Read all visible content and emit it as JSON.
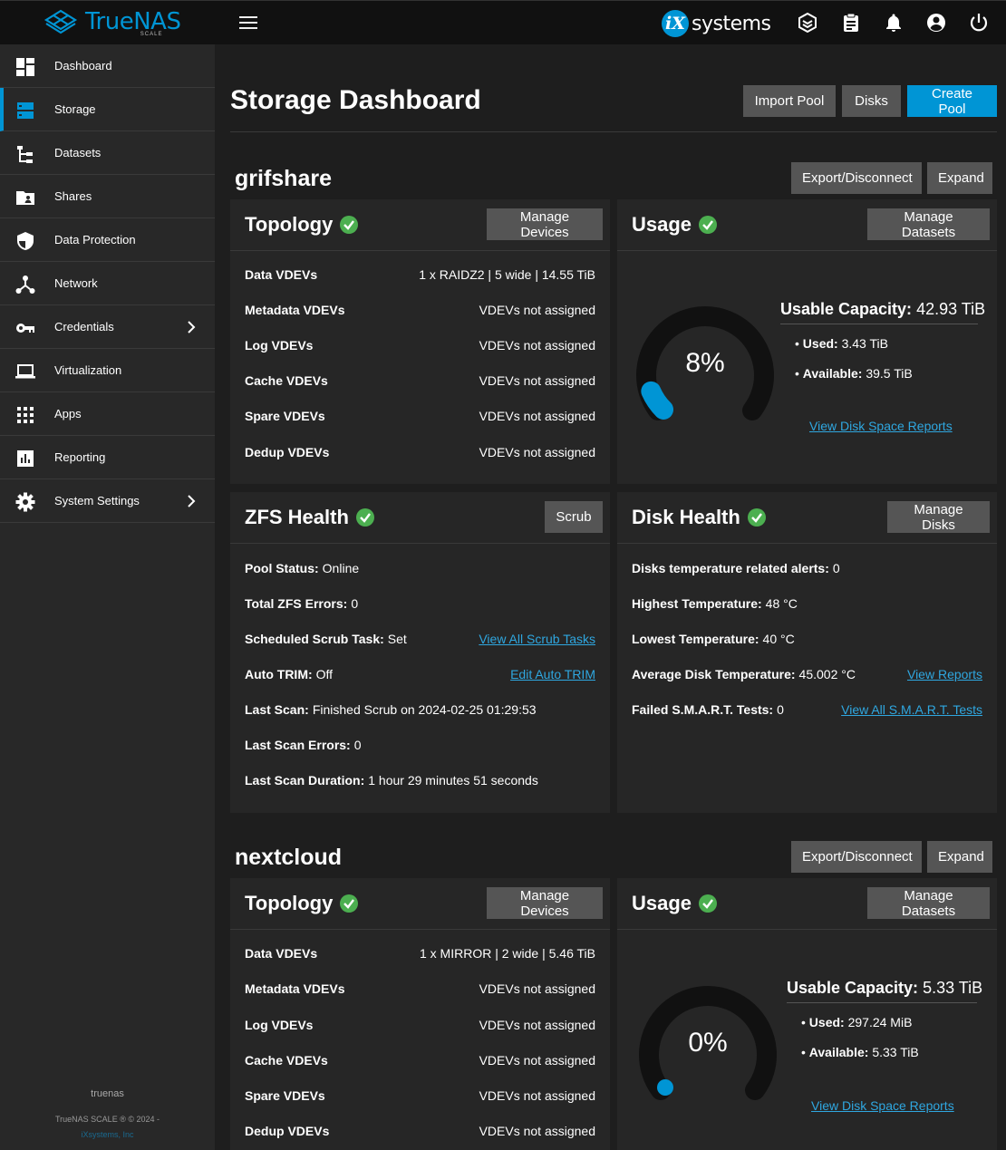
{
  "brand": {
    "name": "TrueNAS",
    "edition": "SCALE"
  },
  "vendor": {
    "mark": "iX",
    "name": "systems"
  },
  "sidebar": {
    "items": [
      {
        "label": "Dashboard"
      },
      {
        "label": "Storage"
      },
      {
        "label": "Datasets"
      },
      {
        "label": "Shares"
      },
      {
        "label": "Data Protection"
      },
      {
        "label": "Network"
      },
      {
        "label": "Credentials"
      },
      {
        "label": "Virtualization"
      },
      {
        "label": "Apps"
      },
      {
        "label": "Reporting"
      },
      {
        "label": "System Settings"
      }
    ],
    "hostname": "truenas",
    "copyright": "TrueNAS SCALE ® © 2024 -",
    "company": "iXsystems, Inc"
  },
  "header": {
    "title": "Storage Dashboard",
    "import_label": "Import Pool",
    "disks_label": "Disks",
    "create_label": "Create Pool"
  },
  "pools": [
    {
      "name": "grifshare",
      "export_label": "Export/Disconnect",
      "expand_label": "Expand",
      "topology": {
        "title": "Topology",
        "button": "Manage Devices",
        "rows": [
          {
            "k": "Data VDEVs",
            "v": "1 x RAIDZ2 | 5 wide | 14.55 TiB"
          },
          {
            "k": "Metadata VDEVs",
            "v": "VDEVs not assigned"
          },
          {
            "k": "Log VDEVs",
            "v": "VDEVs not assigned"
          },
          {
            "k": "Cache VDEVs",
            "v": "VDEVs not assigned"
          },
          {
            "k": "Spare VDEVs",
            "v": "VDEVs not assigned"
          },
          {
            "k": "Dedup VDEVs",
            "v": "VDEVs not assigned"
          }
        ]
      },
      "usage": {
        "title": "Usage",
        "button": "Manage Datasets",
        "percent_label": "8%",
        "percent": 8,
        "capacity_label": "Usable Capacity:",
        "capacity": "42.93 TiB",
        "used_label": "Used:",
        "used": "3.43 TiB",
        "available_label": "Available:",
        "available": "39.5 TiB",
        "link": "View Disk Space Reports"
      },
      "zfs": {
        "title": "ZFS Health",
        "button": "Scrub",
        "rows": [
          {
            "k": "Pool Status:",
            "v": "Online",
            "link": ""
          },
          {
            "k": "Total ZFS Errors:",
            "v": "0",
            "link": ""
          },
          {
            "k": "Scheduled Scrub Task:",
            "v": "Set",
            "link": "View All Scrub Tasks"
          },
          {
            "k": "Auto TRIM:",
            "v": "Off",
            "link": "Edit Auto TRIM"
          },
          {
            "k": "Last Scan:",
            "v": "Finished Scrub on 2024-02-25 01:29:53",
            "link": ""
          },
          {
            "k": "Last Scan Errors:",
            "v": "0",
            "link": ""
          },
          {
            "k": "Last Scan Duration:",
            "v": "1 hour 29 minutes 51 seconds",
            "link": ""
          }
        ]
      },
      "disk": {
        "title": "Disk Health",
        "button": "Manage Disks",
        "rows": [
          {
            "k": "Disks temperature related alerts:",
            "v": "0",
            "link": ""
          },
          {
            "k": "Highest Temperature:",
            "v": "48 °C",
            "link": ""
          },
          {
            "k": "Lowest Temperature:",
            "v": "40 °C",
            "link": ""
          },
          {
            "k": "Average Disk Temperature:",
            "v": "45.002 °C",
            "link": "View Reports"
          },
          {
            "k": "Failed S.M.A.R.T. Tests:",
            "v": "0",
            "link": "View All S.M.A.R.T. Tests"
          }
        ]
      }
    },
    {
      "name": "nextcloud",
      "export_label": "Export/Disconnect",
      "expand_label": "Expand",
      "topology": {
        "title": "Topology",
        "button": "Manage Devices",
        "rows": [
          {
            "k": "Data VDEVs",
            "v": "1 x MIRROR | 2 wide | 5.46 TiB"
          },
          {
            "k": "Metadata VDEVs",
            "v": "VDEVs not assigned"
          },
          {
            "k": "Log VDEVs",
            "v": "VDEVs not assigned"
          },
          {
            "k": "Cache VDEVs",
            "v": "VDEVs not assigned"
          },
          {
            "k": "Spare VDEVs",
            "v": "VDEVs not assigned"
          },
          {
            "k": "Dedup VDEVs",
            "v": "VDEVs not assigned"
          }
        ]
      },
      "usage": {
        "title": "Usage",
        "button": "Manage Datasets",
        "percent_label": "0%",
        "percent": 0,
        "capacity_label": "Usable Capacity:",
        "capacity": "5.33 TiB",
        "used_label": "Used:",
        "used": "297.24 MiB",
        "available_label": "Available:",
        "available": "5.33 TiB",
        "link": "View Disk Space Reports"
      }
    }
  ],
  "colors": {
    "accent": "#0095d5",
    "ok": "#4caf50",
    "panel": "#262626"
  }
}
